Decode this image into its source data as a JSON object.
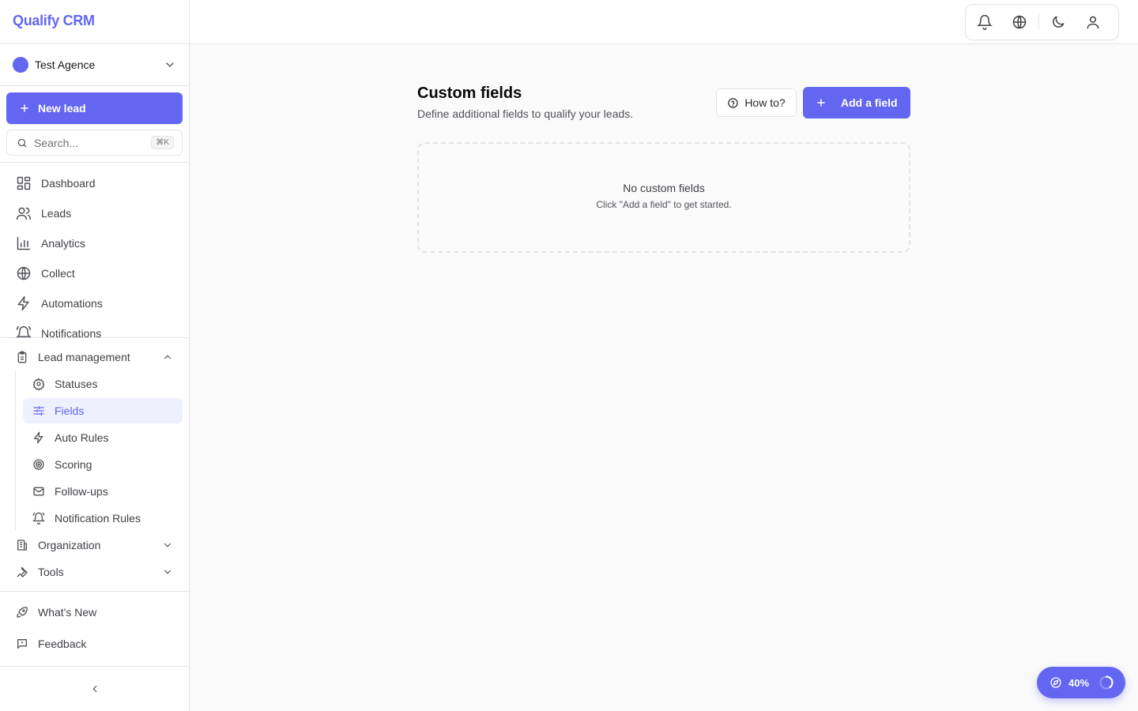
{
  "app": {
    "brand": "Qualify CRM"
  },
  "workspace": {
    "name": "Test Agence"
  },
  "sidebar": {
    "new_lead_label": "New lead",
    "search": {
      "placeholder": "Search...",
      "shortcut": "⌘K"
    },
    "nav": [
      {
        "label": "Dashboard",
        "icon": "dashboard-icon"
      },
      {
        "label": "Leads",
        "icon": "users-icon"
      },
      {
        "label": "Analytics",
        "icon": "bar-chart-icon"
      },
      {
        "label": "Collect",
        "icon": "globe-icon"
      },
      {
        "label": "Automations",
        "icon": "zap-icon"
      },
      {
        "label": "Notifications",
        "icon": "bell-icon"
      }
    ],
    "groups": [
      {
        "label": "Lead management",
        "icon": "clipboard-icon",
        "expanded": true,
        "items": [
          {
            "label": "Statuses",
            "icon": "gear-icon"
          },
          {
            "label": "Fields",
            "icon": "sliders-icon",
            "active": true
          },
          {
            "label": "Auto Rules",
            "icon": "zap-icon"
          },
          {
            "label": "Scoring",
            "icon": "target-icon"
          },
          {
            "label": "Follow-ups",
            "icon": "mail-icon"
          },
          {
            "label": "Notification Rules",
            "icon": "bell-ring-icon"
          }
        ]
      },
      {
        "label": "Organization",
        "icon": "building-icon",
        "expanded": false
      },
      {
        "label": "Tools",
        "icon": "wrench-icon",
        "expanded": false
      }
    ],
    "bottom": [
      {
        "label": "What's New",
        "icon": "rocket-icon"
      },
      {
        "label": "Feedback",
        "icon": "message-square-icon"
      }
    ]
  },
  "topbar": {
    "icons": [
      "bell-icon",
      "globe-icon",
      "moon-icon",
      "user-icon"
    ]
  },
  "main": {
    "title": "Custom fields",
    "subtitle": "Define additional fields to qualify your leads.",
    "how_to_label": "How to?",
    "add_field_label": "Add a field",
    "empty_state": {
      "title": "No custom fields",
      "subtitle": "Click \"Add a field\" to get started."
    }
  },
  "onboarding": {
    "progress_label": "40%",
    "progress": 0.4
  },
  "colors": {
    "accent": "#6366f1",
    "accent_soft": "#eef0fe",
    "border": "#e4e4e7"
  }
}
